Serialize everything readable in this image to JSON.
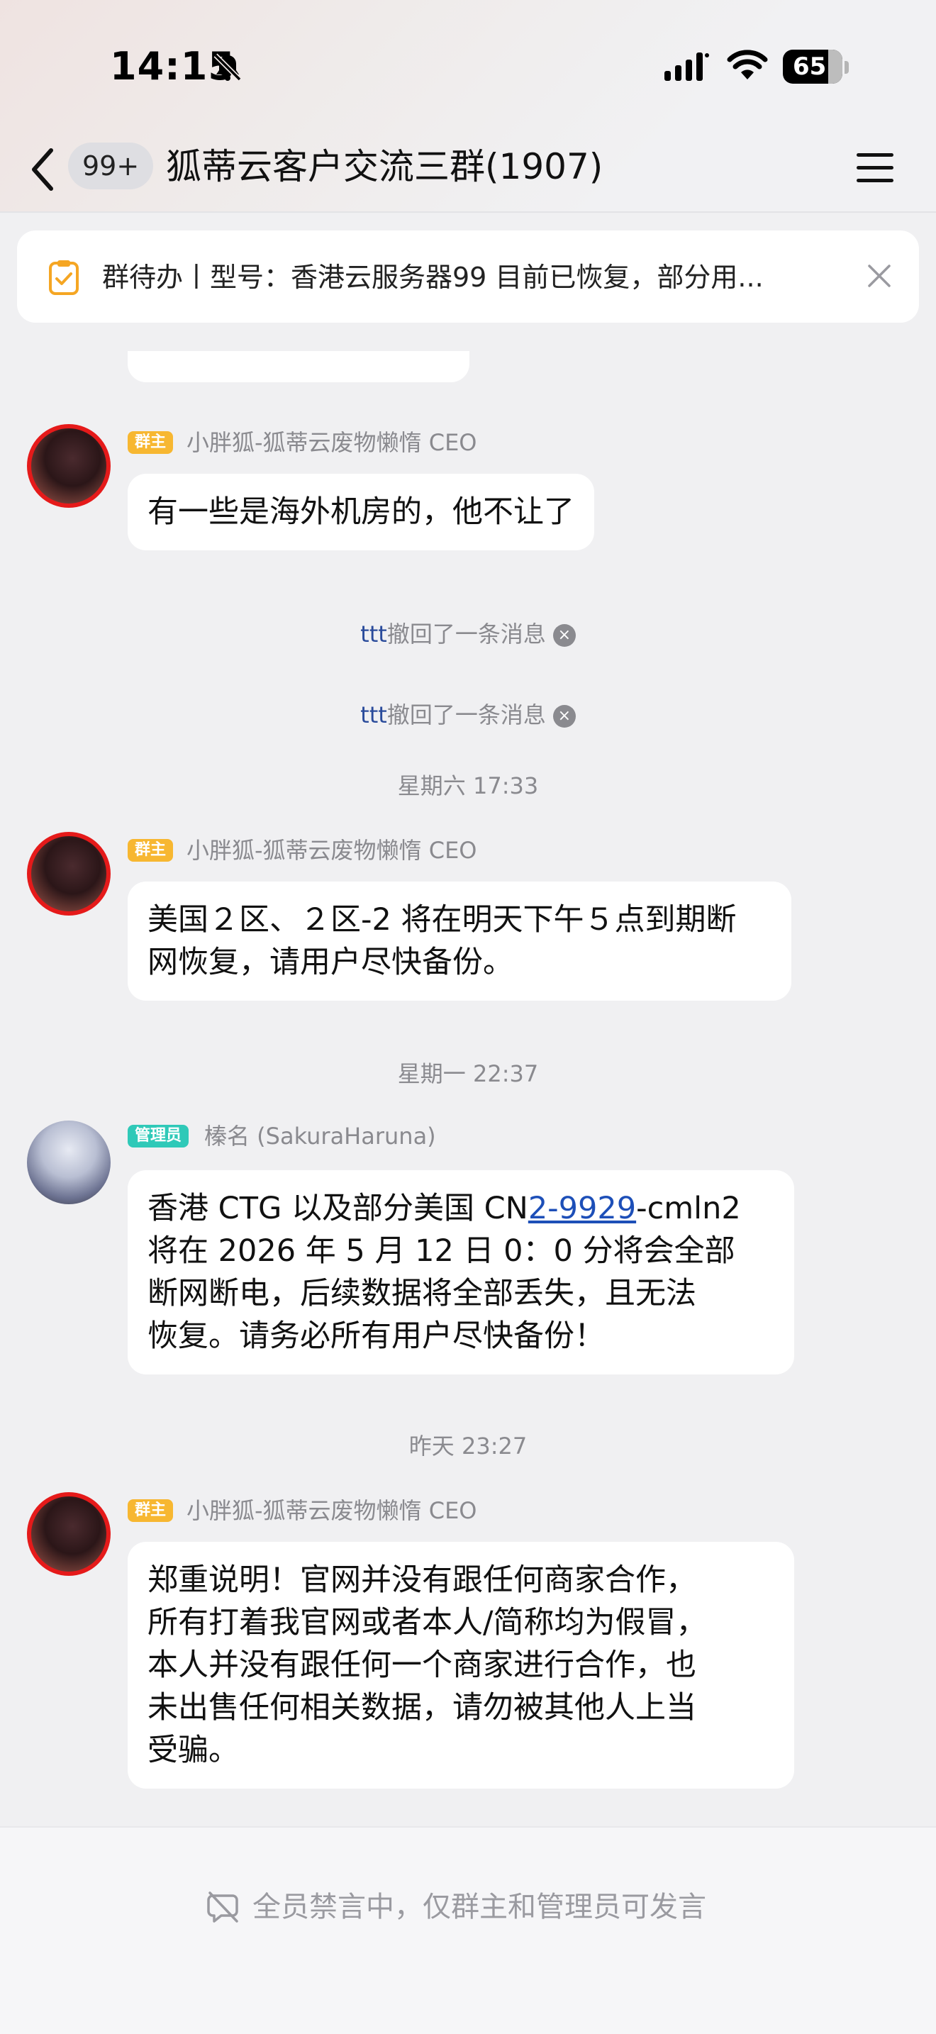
{
  "status_bar": {
    "time": "14:15",
    "battery": "65",
    "icons": [
      "bell-off-icon",
      "signal-icon",
      "wifi-icon",
      "battery-icon"
    ]
  },
  "nav": {
    "back_icon": "chevron-left-icon",
    "unread_count": "99+",
    "title": "狐蒂云客户交流三群(1907)",
    "menu_icon": "hamburger-menu-icon"
  },
  "todo_banner": {
    "icon": "clipboard-check-icon",
    "text": "群待办丨型号：香港云服务器99 目前已恢复，部分用...",
    "close_icon": "close-icon"
  },
  "messages": [
    {
      "role": "群主",
      "sender": "小胖狐-狐蒂云废物懒惰 CEO",
      "text": "有一些是海外机房的，他不让了"
    },
    {
      "role": "群主",
      "sender": "小胖狐-狐蒂云废物懒惰 CEO",
      "lines": [
        "美国２区、２区-2 将在明天下午５点到期断",
        "网恢复，请用户尽快备份。"
      ]
    },
    {
      "role": "管理员",
      "sender": "榛名 (SakuraHaruna)",
      "line1_pre": "香港 CTG 以及部分美国 CN",
      "line1_link": "2-9929",
      "line1_post": "-cmln2",
      "lines": [
        "将在 2026 年 5 月 12 日 0：0 分将会全部",
        "断网断电，后续数据将全部丢失，且无法",
        "恢复。请务必所有用户尽快备份！"
      ]
    },
    {
      "role": "群主",
      "sender": "小胖狐-狐蒂云废物懒惰 CEO",
      "lines": [
        "郑重说明！官网并没有跟任何商家合作，",
        "所有打着我官网或者本人/简称均为假冒，",
        "本人并没有跟任何一个商家进行合作，也",
        "未出售任何相关数据，请勿被其他人上当",
        "受骗。"
      ]
    }
  ],
  "system": {
    "recall_user": "ttt",
    "recall_text": "撤回了一条消息",
    "time_1": "星期六 17:33",
    "time_2": "星期一 22:37",
    "time_3": "昨天 23:27"
  },
  "footer": {
    "icon": "mute-icon",
    "text": "全员禁言中，仅群主和管理员可发言"
  }
}
